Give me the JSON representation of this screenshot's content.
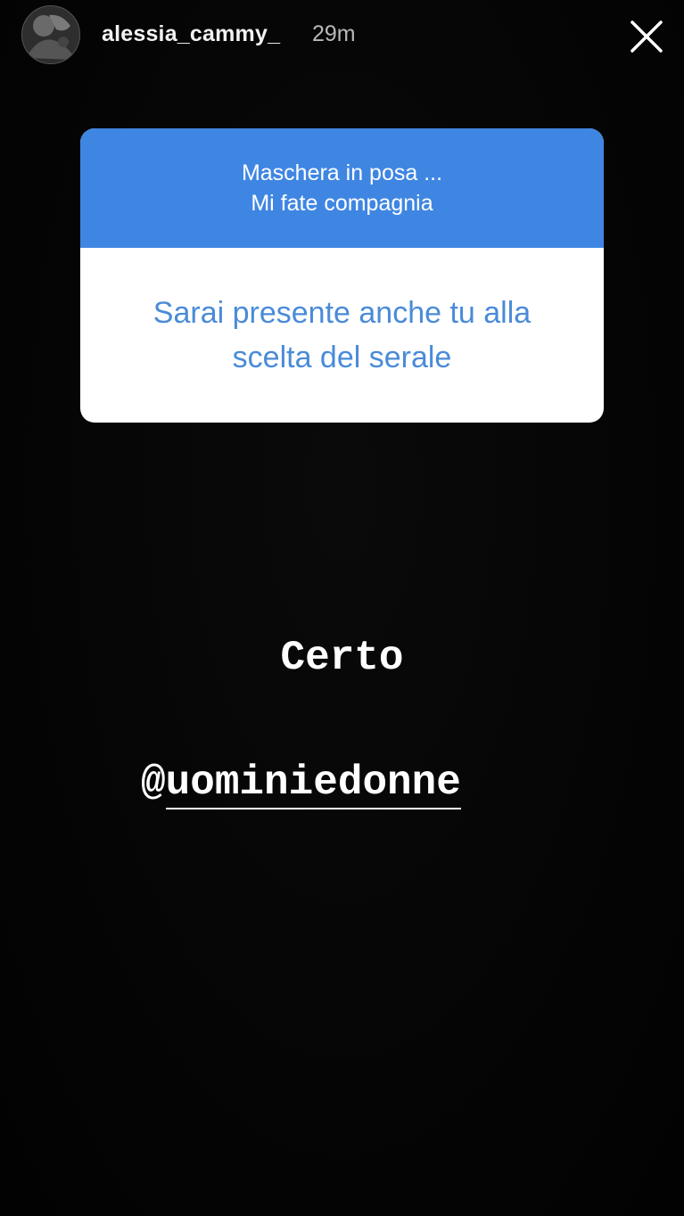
{
  "story": {
    "username": "alessia_cammy_",
    "timestamp": "29m",
    "close_icon": "close-icon"
  },
  "question_sticker": {
    "prompt_line1": "Maschera in posa ...",
    "prompt_line2": "Mi fate compagnia",
    "question": "Sarai presente anche tu alla scelta del serale",
    "header_color": "#3f86e3",
    "question_color": "#4a8bd8"
  },
  "answer": {
    "text": "Certo",
    "mention_at": "@",
    "mention_handle": "uominiedonne"
  }
}
